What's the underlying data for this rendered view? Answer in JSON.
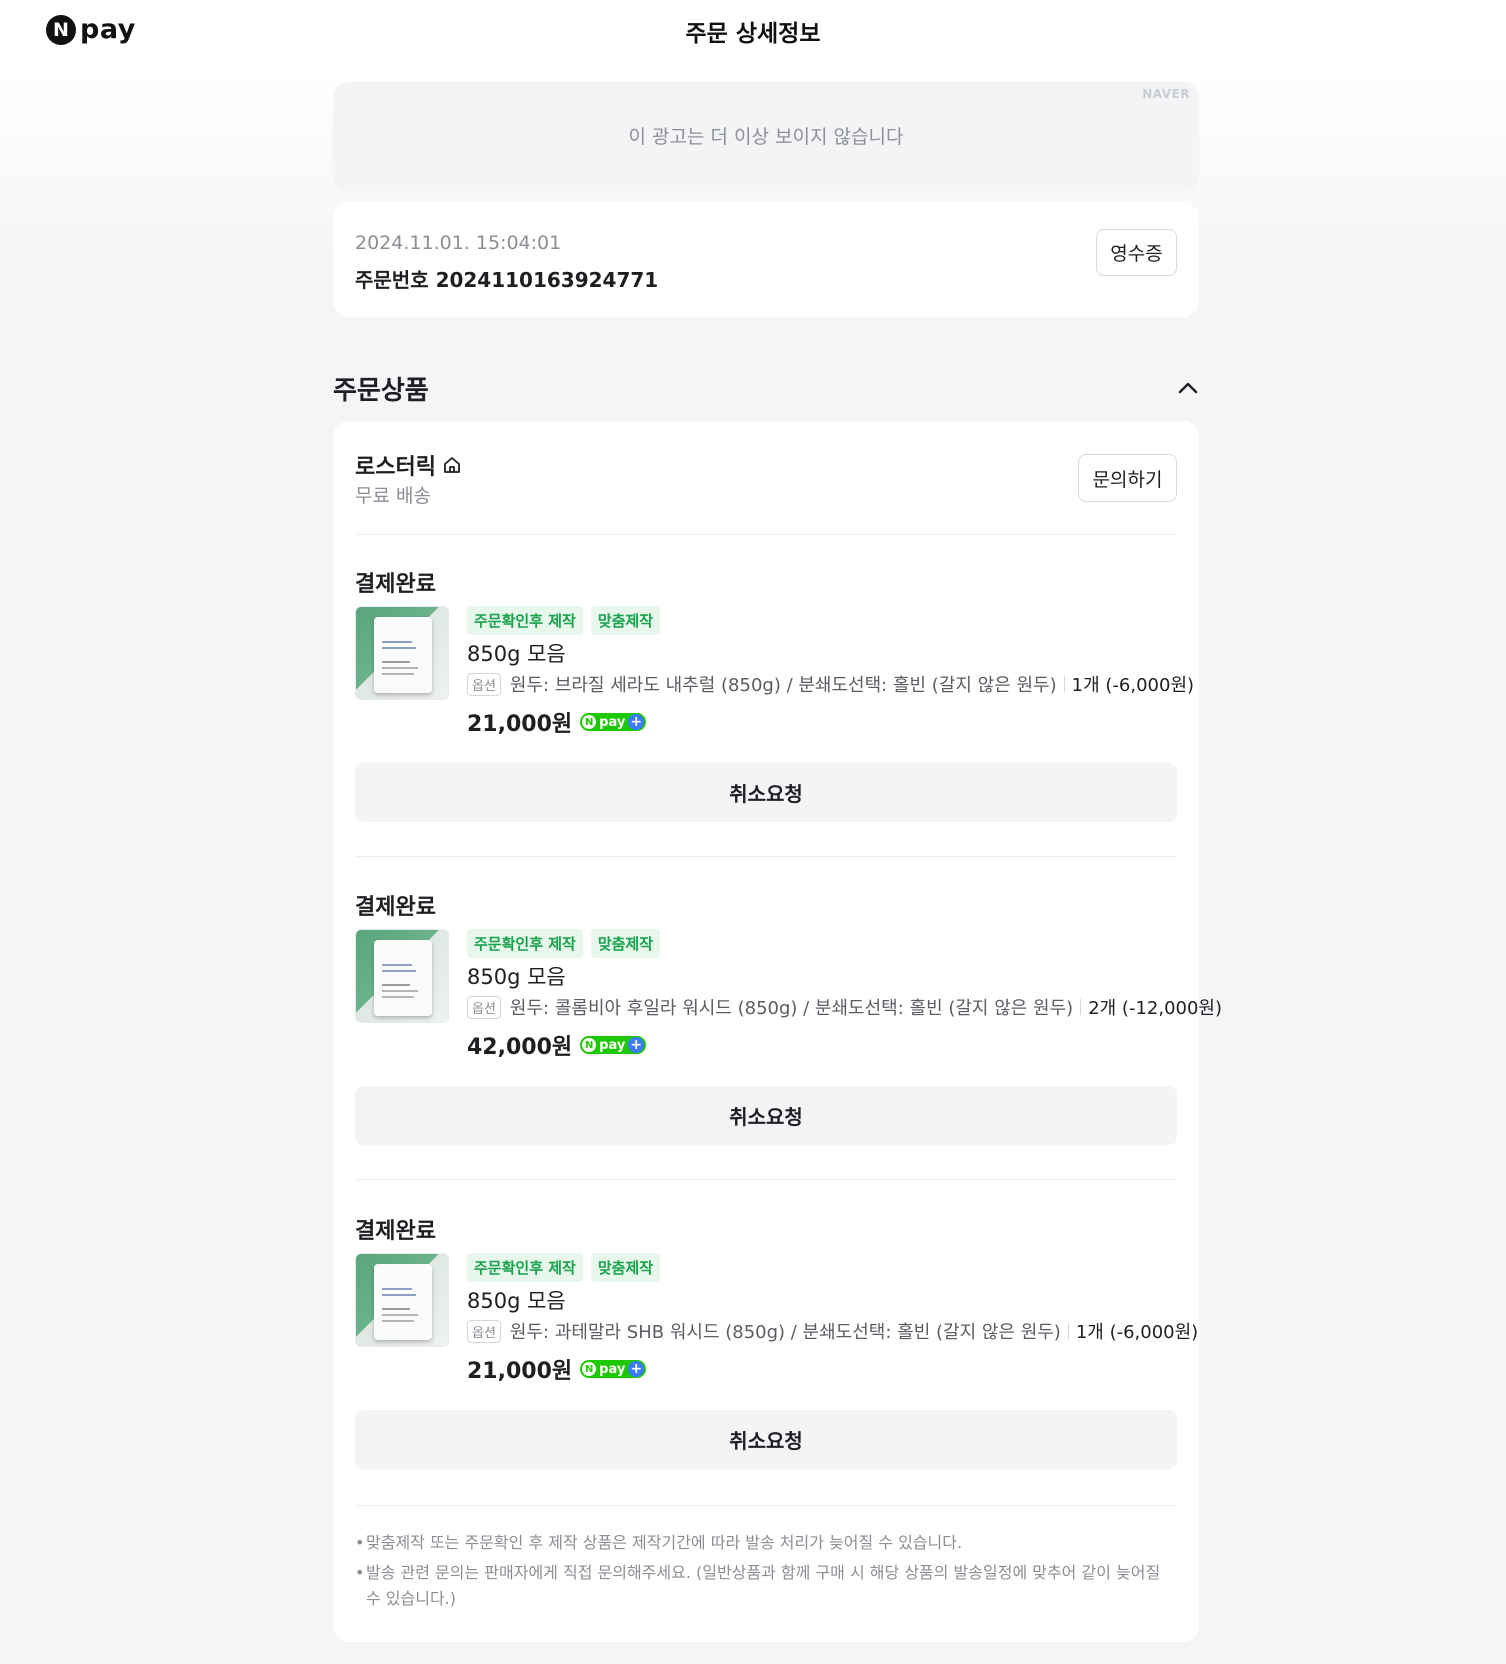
{
  "header": {
    "logo_letter": "N",
    "logo_text": "pay",
    "title": "주문 상세정보"
  },
  "ad": {
    "brand": "NAVER",
    "message": "이 광고는 더 이상 보이지 않습니다"
  },
  "order": {
    "datetime": "2024.11.01. 15:04:01",
    "number_label": "주문번호 2024110163924771",
    "receipt_button": "영수증"
  },
  "section": {
    "title": "주문상품",
    "collapse_icon": "chevron-up-icon"
  },
  "seller": {
    "name": "로스터릭",
    "icon": "home-icon",
    "shipping": "무료 배송",
    "inquiry_button": "문의하기"
  },
  "items": [
    {
      "status": "결제완료",
      "tags": [
        "주문확인후 제작",
        "맞춤제작"
      ],
      "name": "850g 모음",
      "option_badge": "옵션",
      "option_text": "원두: 브라질 세라도 내추럴 (850g) / 분쇄도선택: 홀빈 (갈지 않은 원두)",
      "quantity": "1개 (-6,000원)",
      "price": "21,000원",
      "npay_badge": "pay",
      "cancel_button": "취소요청"
    },
    {
      "status": "결제완료",
      "tags": [
        "주문확인후 제작",
        "맞춤제작"
      ],
      "name": "850g 모음",
      "option_badge": "옵션",
      "option_text": "원두: 콜롬비아 후일라 워시드 (850g) / 분쇄도선택: 홀빈 (갈지 않은 원두)",
      "quantity": "2개 (-12,000원)",
      "price": "42,000원",
      "npay_badge": "pay",
      "cancel_button": "취소요청"
    },
    {
      "status": "결제완료",
      "tags": [
        "주문확인후 제작",
        "맞춤제작"
      ],
      "name": "850g 모음",
      "option_badge": "옵션",
      "option_text": "원두: 과테말라 SHB 워시드 (850g) / 분쇄도선택: 홀빈 (갈지 않은 원두)",
      "quantity": "1개 (-6,000원)",
      "price": "21,000원",
      "npay_badge": "pay",
      "cancel_button": "취소요청"
    }
  ],
  "notes": [
    "맞춤제작 또는 주문확인 후 제작 상품은 제작기간에 따라 발송 처리가 늦어질 수 있습니다.",
    "발송 관련 문의는 판매자에게 직접 문의해주세요. (일반상품과 함께 구매 시 해당 상품의 발송일정에 맞추어 같이 늦어질 수 있습니다.)"
  ],
  "colors": {
    "tag_green": "#16a34a",
    "tag_bg": "#e8f7ec",
    "npay_green": "#1ec800",
    "npay_blue": "#3a7bff"
  }
}
